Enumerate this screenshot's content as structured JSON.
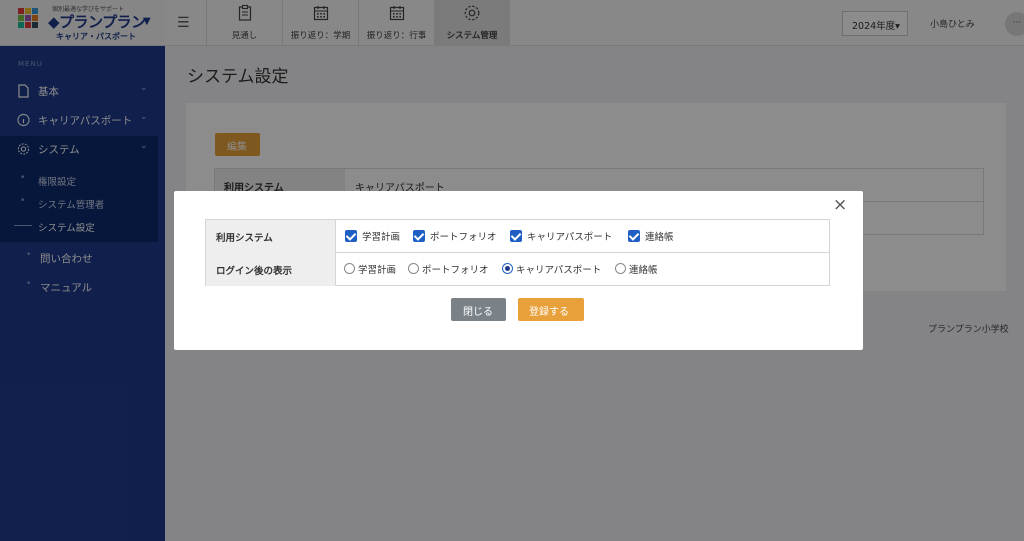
{
  "logo": {
    "tagline": "個別最適な学びをサポート",
    "brand": "◆プランプラン",
    "subtitle": "キャリア・パスポート"
  },
  "sidebar": {
    "caption": "MENU",
    "items": [
      {
        "label": "基本",
        "icon": "document-icon"
      },
      {
        "label": "キャリアパスポート",
        "icon": "info-circle-icon"
      },
      {
        "label": "システム",
        "icon": "gear-icon"
      }
    ],
    "sub_items": [
      "権限設定",
      "システム管理者",
      "システム設定"
    ],
    "extra_items": [
      "問い合わせ",
      "マニュアル"
    ]
  },
  "header": {
    "tabs": [
      {
        "label": "見通し",
        "icon": "clipboard-icon"
      },
      {
        "label": "振り返り：学期",
        "icon": "calendar-icon"
      },
      {
        "label": "振り返り：行事",
        "icon": "calendar-icon"
      },
      {
        "label": "システム管理",
        "icon": "gear-icon",
        "active": true
      }
    ],
    "year": "2024年度▾",
    "user": "小島ひとみ",
    "more": "···"
  },
  "main": {
    "title": "システム設定",
    "edit_label": "編集",
    "rows": [
      {
        "label": "利用システム",
        "value": "キャリアパスポート"
      }
    ],
    "school": "プランプラン小学校"
  },
  "modal": {
    "close_icon": "×",
    "row1_label": "利用システム",
    "row1_options": [
      "学習計画",
      "ポートフォリオ",
      "キャリアパスポート",
      "連絡帳"
    ],
    "row2_label": "ログイン後の表示",
    "row2_options": [
      "学習計画",
      "ポートフォリオ",
      "キャリアパスポート",
      "連絡帳"
    ],
    "row2_selected": "キャリアパスポート",
    "close_label": "閉じる",
    "save_label": "登録する"
  },
  "colors": {
    "sidebar": "#1f3a8a",
    "accent": "#e8a03a",
    "check": "#1f5fc4"
  }
}
